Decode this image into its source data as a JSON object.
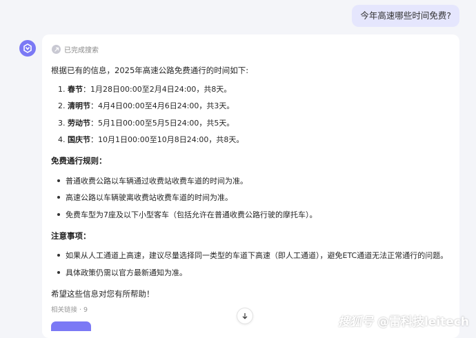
{
  "user_message": "今年高速哪些时间免费?",
  "search_status": "已完成搜索",
  "intro": "根据已有的信息，2025年高速公路免费通行的时间如下:",
  "holidays": [
    {
      "num": "1.",
      "name": "春节",
      "text": "：1月28日00:00至2月4日24:00，共8天。"
    },
    {
      "num": "2.",
      "name": "清明节",
      "text": "：4月4日00:00至4月6日24:00，共3天。"
    },
    {
      "num": "3.",
      "name": "劳动节",
      "text": "：5月1日00:00至5月5日24:00，共5天。"
    },
    {
      "num": "4.",
      "name": "国庆节",
      "text": "：10月1日00:00至10月8日24:00，共8天。"
    }
  ],
  "rules": {
    "heading": "免费通行规则：",
    "items": [
      "普通收费公路以车辆通过收费站收费车道的时间为准。",
      "高速公路以车辆驶离收费站收费车道的时间为准。",
      "免费车型为7座及以下小型客车（包括允许在普通收费公路行驶的摩托车）。"
    ]
  },
  "notes": {
    "heading": "注意事项：",
    "items": [
      "如果从人工通道上高速，建议尽量选择同一类型的车道下高速（即人工通道），避免ETC通道无法正常通行的问题。",
      "具体政策仍需以官方最新通知为准。"
    ]
  },
  "closing": "希望这些信息对您有所帮助！",
  "related_links": "相关链接 · 9",
  "watermark": {
    "logo": "搜狐号",
    "text": "@雷科技leitech"
  },
  "colors": {
    "accent": "#7b79f5",
    "user_bubble": "#e5e6fd",
    "background": "#f4f5f9"
  }
}
